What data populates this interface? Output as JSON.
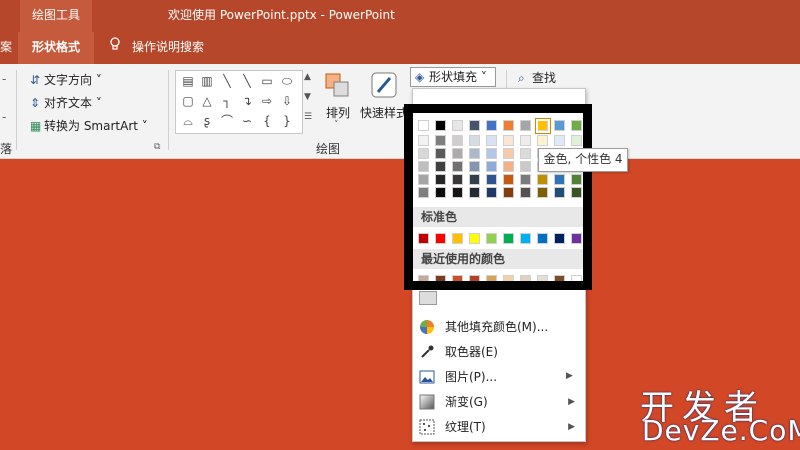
{
  "titlebar": {
    "context_tab": "绘图工具",
    "document_title": "欢迎使用 PowerPoint.pptx  -  PowerPoint"
  },
  "tabs": {
    "cut_tab": "案",
    "active_tab": "形状格式",
    "tell_me": "操作说明搜索"
  },
  "ribbon": {
    "text_direction": "文字方向",
    "align_text": "对齐文本",
    "convert_smartart": "转换为 SmartArt",
    "arrange": "排列",
    "quick_styles": "快速样式",
    "group_drawing": "绘图",
    "group_left_cut": "落",
    "shape_fill": "形状填充",
    "find": "查找"
  },
  "menu": {
    "theme_colors_rows": [
      [
        "#ffffff",
        "#000000",
        "#e7e6e6",
        "#44546a",
        "#4472c4",
        "#ed7d31",
        "#a5a5a5",
        "#ffc000",
        "#5b9bd5",
        "#70ad47"
      ],
      [
        "#f2f2f2",
        "#7f7f7f",
        "#d0cece",
        "#d6dce4",
        "#d9e2f3",
        "#fbe5d5",
        "#ededed",
        "#fff2cc",
        "#deebf6",
        "#e2efd9"
      ],
      [
        "#d8d8d8",
        "#595959",
        "#aeabab",
        "#adb9ca",
        "#b4c6e7",
        "#f7caac",
        "#dbdbdb",
        "#fee599",
        "#bdd7ee",
        "#c5e0b3"
      ],
      [
        "#bfbfbf",
        "#3f3f3f",
        "#757070",
        "#8496b0",
        "#8eaadb",
        "#f4b183",
        "#c9c9c9",
        "#ffd965",
        "#9cc3e5",
        "#a8d08d"
      ],
      [
        "#a5a5a5",
        "#262626",
        "#3a3838",
        "#323f4f",
        "#2f5496",
        "#c55a11",
        "#7b7b7b",
        "#bf8f00",
        "#2e75b5",
        "#538135"
      ],
      [
        "#7f7f7f",
        "#0c0c0c",
        "#171616",
        "#222a35",
        "#1f3864",
        "#843c0b",
        "#525252",
        "#7f6000",
        "#1e4e79",
        "#375623"
      ]
    ],
    "standard_colors_label": "标准色",
    "standard_colors": [
      "#c00000",
      "#ff0000",
      "#ffc000",
      "#ffff00",
      "#92d050",
      "#00b050",
      "#00b0f0",
      "#0070c0",
      "#002060",
      "#7030a0"
    ],
    "recent_colors_label": "最近使用的颜色",
    "recent_colors": [
      "#c9a99a",
      "#7a3b1f",
      "#c8502f",
      "#b5402a",
      "#d4a45a",
      "#f0d4a8",
      "#e0d2bf",
      "#e6ddd3",
      "#7a4a2a",
      "#ffffff"
    ],
    "items": [
      {
        "label": "其他填充颜色(M)...",
        "icon": "color-wheel-icon",
        "submenu": false
      },
      {
        "label": "取色器(E)",
        "icon": "eyedropper-icon",
        "submenu": false
      },
      {
        "label": "图片(P)...",
        "icon": "picture-icon",
        "submenu": true
      },
      {
        "label": "渐变(G)",
        "icon": "gradient-icon",
        "submenu": true
      },
      {
        "label": "纹理(T)",
        "icon": "texture-icon",
        "submenu": true
      }
    ],
    "tooltip": "金色, 个性色 4"
  },
  "watermark": {
    "line1": "开发者",
    "line2": "DevZe.CoM"
  },
  "colors": {
    "accent": "#b7472a",
    "slide_background": "#d24726"
  }
}
